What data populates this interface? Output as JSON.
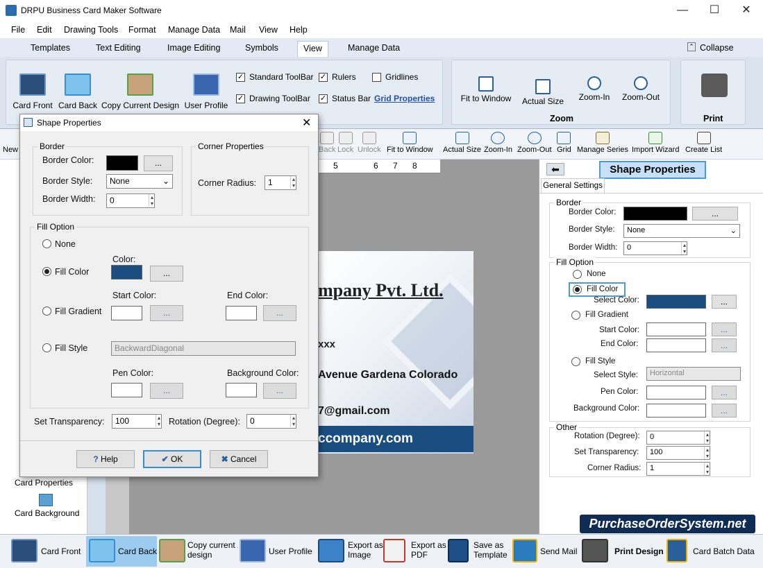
{
  "app": {
    "title": "DRPU Business Card Maker Software"
  },
  "window_controls": {
    "minimize": "—",
    "maximize": "☐",
    "close": "✕"
  },
  "menu": [
    "File",
    "Edit",
    "Drawing Tools",
    "Format",
    "Manage Data",
    "Mail",
    "View",
    "Help"
  ],
  "ribbon_tabs": [
    "Templates",
    "Text Editing",
    "Image Editing",
    "Symbols",
    "View",
    "Manage Data"
  ],
  "ribbon_active_tab": "View",
  "collapse_label": "Collapse",
  "ribbon": {
    "big_buttons": [
      "Card Front",
      "Card Back",
      "Copy Current Design",
      "User Profile"
    ],
    "checks": [
      {
        "label": "Standard ToolBar",
        "checked": true
      },
      {
        "label": "Rulers",
        "checked": true
      },
      {
        "label": "Gridlines",
        "checked": false
      },
      {
        "label": "Drawing ToolBar",
        "checked": true
      },
      {
        "label": "Status Bar",
        "checked": true
      }
    ],
    "grid_properties": "Grid Properties",
    "zoom_buttons": [
      "Fit to Window",
      "Actual Size",
      "Zoom-In",
      "Zoom-Out"
    ],
    "zoom_group": "Zoom",
    "print_group": "Print"
  },
  "toolbar2": [
    "New",
    "Back",
    "Lock",
    "Unlock",
    "Fit to Window",
    "Actual Size",
    "Zoom-In",
    "Zoom-Out",
    "Grid",
    "Manage Series",
    "Import Wizard",
    "Create List"
  ],
  "ruler_numbers": [
    "5",
    "6",
    "7",
    "8"
  ],
  "card": {
    "company": "mpany Pvt. Ltd.",
    "phone": "xxx",
    "address": "Avenue Gardena Colorado",
    "email": "7@gmail.com",
    "website": "ccompany.com"
  },
  "left_panel": {
    "card_properties": "Card Properties",
    "card_background": "Card Background"
  },
  "dialog": {
    "title": "Shape Properties",
    "border_legend": "Border",
    "border_color_label": "Border Color:",
    "browse": "...",
    "border_style_label": "Border Style:",
    "border_style_value": "None",
    "border_width_label": "Border Width:",
    "border_width_value": "0",
    "corner_legend": "Corner Properties",
    "corner_radius_label": "Corner Radius:",
    "corner_radius_value": "1",
    "fill_legend": "Fill Option",
    "none_label": "None",
    "fill_color_label": "Fill Color",
    "color_label": "Color:",
    "start_color_label": "Start Color:",
    "end_color_label": "End Color:",
    "fill_gradient_label": "Fill Gradient",
    "fill_style_label": "Fill Style",
    "fill_style_value": "BackwardDiagonal",
    "pen_color_label": "Pen Color:",
    "bg_color_label": "Background Color:",
    "transparency_label": "Set Transparency:",
    "transparency_value": "100",
    "rotation_label": "Rotation (Degree):",
    "rotation_value": "0",
    "help": "Help",
    "ok": "OK",
    "cancel": "Cancel"
  },
  "right_panel": {
    "title": "Shape Properties",
    "tab": "General Settings",
    "border": "Border",
    "border_color": "Border Color:",
    "browse": "...",
    "border_style": "Border Style:",
    "border_style_value": "None",
    "border_width": "Border Width:",
    "border_width_value": "0",
    "fill_option": "Fill Option",
    "none": "None",
    "fill_color": "Fill Color",
    "select_color": "Select Color:",
    "fill_gradient": "Fill Gradient",
    "start_color": "Start Color:",
    "end_color": "End Color:",
    "fill_style": "Fill Style",
    "select_style": "Select Style:",
    "select_style_value": "Horizontal",
    "pen_color": "Pen Color:",
    "bg_color": "Background Color:",
    "other": "Other",
    "rotation": "Rotation (Degree):",
    "rotation_value": "0",
    "transparency": "Set Transparency:",
    "transparency_value": "100",
    "corner_radius": "Corner Radius:",
    "corner_radius_value": "1"
  },
  "watermark": "PurchaseOrderSystem.net",
  "bottom_bar": [
    {
      "label": "Card Front"
    },
    {
      "label": "Card Back"
    },
    {
      "label": "Copy current\ndesign"
    },
    {
      "label": "User Profile"
    },
    {
      "label": "Export as\nImage"
    },
    {
      "label": "Export as\nPDF"
    },
    {
      "label": "Save as\nTemplate"
    },
    {
      "label": "Send Mail"
    },
    {
      "label": "Print Design"
    },
    {
      "label": "Card Batch Data"
    }
  ],
  "colors": {
    "fill": "#1a4e80",
    "accent": "#2b6cb0",
    "border_black": "#000000"
  }
}
